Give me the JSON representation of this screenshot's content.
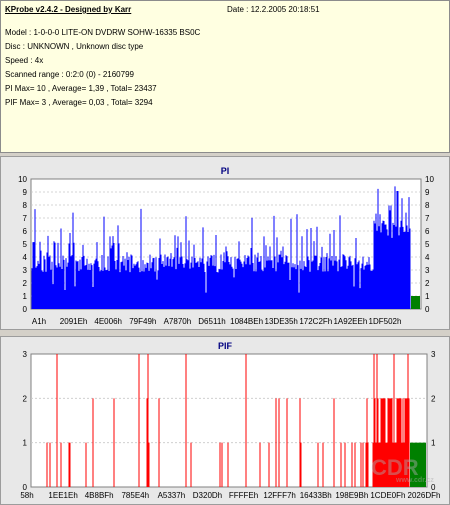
{
  "info": {
    "title": "KProbe v2.4.2 - Designed by Karr",
    "date": "Date : 12.2.2005 20:18:51",
    "model": "Model : 1-0-0-0 LITE-ON DVDRW SOHW-16335 BS0C",
    "disc": "Disc : UNKNOWN , Unknown disc type",
    "speed": "Speed : 4x",
    "range": "Scanned range : 0:2:0 (0) - 2160799",
    "pi_stats": "PI Max= 10 , Average= 1,39 , Total= 23437",
    "pif_stats": "PIF Max= 3 , Average= 0,03 , Total= 3294"
  },
  "pi_chart": {
    "title": "PI",
    "color": "#0000ff",
    "speed_color": "#008000",
    "ylim": [
      0,
      10
    ],
    "yticks": [
      "0",
      "1",
      "2",
      "3",
      "4",
      "5",
      "6",
      "7",
      "8",
      "9",
      "10"
    ],
    "xticks": [
      "A1h",
      "2091Eh",
      "4E006h",
      "79F49h",
      "A7870h",
      "D6511h",
      "1084BEh",
      "13DE35h",
      "172C2Fh",
      "1A92EEh",
      "1DF502h"
    ]
  },
  "pif_chart": {
    "title": "PIF",
    "color": "#ff0000",
    "speed_color": "#008000",
    "ylim": [
      0,
      3
    ],
    "yticks": [
      "0",
      "1",
      "2",
      "3"
    ],
    "xticks": [
      "58h",
      "1EE1Eh",
      "4B8BFh",
      "785E4h",
      "A5337h",
      "D320Dh",
      "FFFFEh",
      "12FFF7h",
      "16433Bh",
      "198E9Bh",
      "1CDE0Fh",
      "2026DFh"
    ]
  },
  "watermark": {
    "logo": "CDR",
    "url": "www.cdr.cz"
  }
}
